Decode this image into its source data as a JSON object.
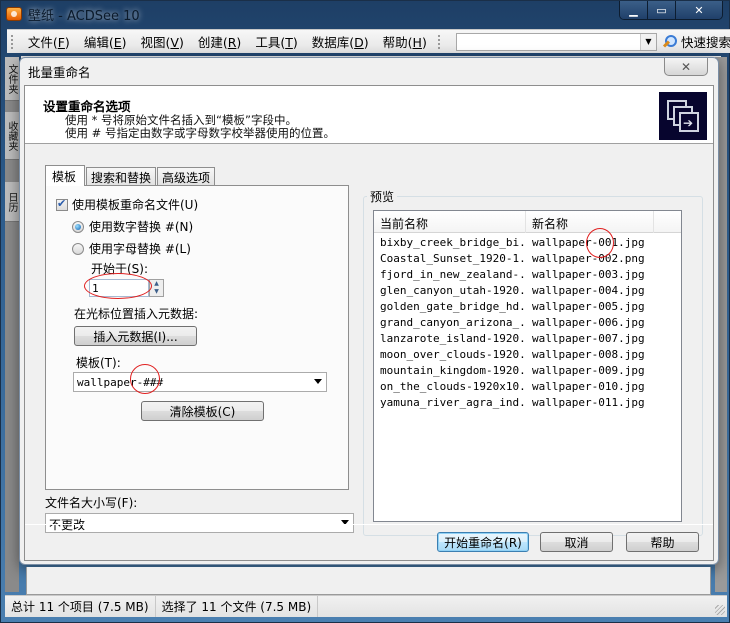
{
  "window": {
    "title": "壁纸 - ACDSee 10",
    "controls": {
      "minimize": "minimize",
      "maximize": "maximize",
      "close": "close"
    }
  },
  "menubar": {
    "items": [
      {
        "label": "文件(",
        "key": "F",
        "suffix": ")"
      },
      {
        "label": "编辑(",
        "key": "E",
        "suffix": ")"
      },
      {
        "label": "视图(",
        "key": "V",
        "suffix": ")"
      },
      {
        "label": "创建(",
        "key": "R",
        "suffix": ")"
      },
      {
        "label": "工具(",
        "key": "T",
        "suffix": ")"
      },
      {
        "label": "数据库(",
        "key": "D",
        "suffix": ")"
      },
      {
        "label": "帮助(",
        "key": "H",
        "suffix": ")"
      }
    ],
    "search_value": "",
    "quick_search_label": "快速搜索"
  },
  "side_tabs": [
    "文件夹",
    "收藏夹",
    "日历"
  ],
  "dialog": {
    "title": "批量重命名",
    "close_icon": "close-icon",
    "header": {
      "title": "设置重命名选项",
      "line1": "使用 * 号将原始文件名插入到“模板”字段中。",
      "line2": "使用 # 号指定由数字或字母数字校举器使用的位置。"
    },
    "tabs": [
      {
        "label": "模板",
        "active": true
      },
      {
        "label": "搜索和替换",
        "active": false
      },
      {
        "label": "高级选项",
        "active": false
      }
    ],
    "template_tab": {
      "use_template_label": "使用模板重命名文件(U)",
      "use_template_checked": true,
      "radio_number_label": "使用数字替换 #(N)",
      "radio_number_selected": true,
      "radio_letter_label": "使用字母替换 #(L)",
      "radio_letter_selected": false,
      "start_at_label": "开始于(S):",
      "start_at_value": "1",
      "insert_metadata_label": "在光标位置插入元数据:",
      "insert_metadata_button": "插入元数据(I)...",
      "template_label": "模板(T):",
      "template_value": "wallpaper-###",
      "clear_template_button": "清除模板(C)"
    },
    "filename_case": {
      "label": "文件名大小写(F):",
      "value": "不更改"
    },
    "preview": {
      "title": "预览",
      "columns": [
        "当前名称",
        "新名称"
      ],
      "rows": [
        {
          "current": "bixby_creek_bridge_bi...",
          "new": "wallpaper-001.jpg"
        },
        {
          "current": "Coastal_Sunset_1920-1...",
          "new": "wallpaper-002.png"
        },
        {
          "current": "fjord_in_new_zealand-...",
          "new": "wallpaper-003.jpg"
        },
        {
          "current": "glen_canyon_utah-1920...",
          "new": "wallpaper-004.jpg"
        },
        {
          "current": "golden_gate_bridge_hd...",
          "new": "wallpaper-005.jpg"
        },
        {
          "current": "grand_canyon_arizona_...",
          "new": "wallpaper-006.jpg"
        },
        {
          "current": "lanzarote_island-1920...",
          "new": "wallpaper-007.jpg"
        },
        {
          "current": "moon_over_clouds-1920...",
          "new": "wallpaper-008.jpg"
        },
        {
          "current": "mountain_kingdom-1920...",
          "new": "wallpaper-009.jpg"
        },
        {
          "current": "on_the_clouds-1920x10...",
          "new": "wallpaper-010.jpg"
        },
        {
          "current": "yamuna_river_agra_ind...",
          "new": "wallpaper-011.jpg"
        }
      ]
    },
    "buttons": {
      "start": "开始重命名(R)",
      "cancel": "取消",
      "help": "帮助"
    }
  },
  "statusbar": {
    "total": "总计 11 个项目 (7.5 MB)",
    "selected": "选择了 11 个文件 (7.5 MB)"
  },
  "colors": {
    "annotation": "#e02020",
    "header_icon_bg": "#07052e",
    "default_button_border": "#3c7fb1"
  }
}
